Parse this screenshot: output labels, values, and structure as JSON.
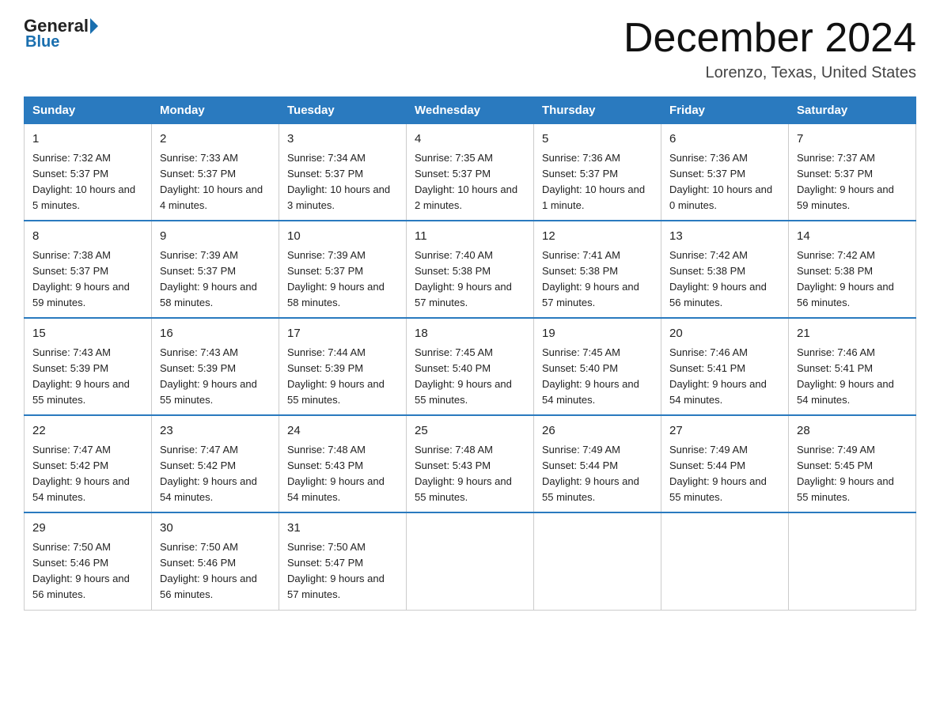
{
  "logo": {
    "general": "General",
    "blue": "Blue",
    "triangle": ""
  },
  "header": {
    "title": "December 2024",
    "subtitle": "Lorenzo, Texas, United States"
  },
  "weekdays": [
    "Sunday",
    "Monday",
    "Tuesday",
    "Wednesday",
    "Thursday",
    "Friday",
    "Saturday"
  ],
  "weeks": [
    [
      {
        "day": "1",
        "sunrise": "7:32 AM",
        "sunset": "5:37 PM",
        "daylight": "10 hours and 5 minutes."
      },
      {
        "day": "2",
        "sunrise": "7:33 AM",
        "sunset": "5:37 PM",
        "daylight": "10 hours and 4 minutes."
      },
      {
        "day": "3",
        "sunrise": "7:34 AM",
        "sunset": "5:37 PM",
        "daylight": "10 hours and 3 minutes."
      },
      {
        "day": "4",
        "sunrise": "7:35 AM",
        "sunset": "5:37 PM",
        "daylight": "10 hours and 2 minutes."
      },
      {
        "day": "5",
        "sunrise": "7:36 AM",
        "sunset": "5:37 PM",
        "daylight": "10 hours and 1 minute."
      },
      {
        "day": "6",
        "sunrise": "7:36 AM",
        "sunset": "5:37 PM",
        "daylight": "10 hours and 0 minutes."
      },
      {
        "day": "7",
        "sunrise": "7:37 AM",
        "sunset": "5:37 PM",
        "daylight": "9 hours and 59 minutes."
      }
    ],
    [
      {
        "day": "8",
        "sunrise": "7:38 AM",
        "sunset": "5:37 PM",
        "daylight": "9 hours and 59 minutes."
      },
      {
        "day": "9",
        "sunrise": "7:39 AM",
        "sunset": "5:37 PM",
        "daylight": "9 hours and 58 minutes."
      },
      {
        "day": "10",
        "sunrise": "7:39 AM",
        "sunset": "5:37 PM",
        "daylight": "9 hours and 58 minutes."
      },
      {
        "day": "11",
        "sunrise": "7:40 AM",
        "sunset": "5:38 PM",
        "daylight": "9 hours and 57 minutes."
      },
      {
        "day": "12",
        "sunrise": "7:41 AM",
        "sunset": "5:38 PM",
        "daylight": "9 hours and 57 minutes."
      },
      {
        "day": "13",
        "sunrise": "7:42 AM",
        "sunset": "5:38 PM",
        "daylight": "9 hours and 56 minutes."
      },
      {
        "day": "14",
        "sunrise": "7:42 AM",
        "sunset": "5:38 PM",
        "daylight": "9 hours and 56 minutes."
      }
    ],
    [
      {
        "day": "15",
        "sunrise": "7:43 AM",
        "sunset": "5:39 PM",
        "daylight": "9 hours and 55 minutes."
      },
      {
        "day": "16",
        "sunrise": "7:43 AM",
        "sunset": "5:39 PM",
        "daylight": "9 hours and 55 minutes."
      },
      {
        "day": "17",
        "sunrise": "7:44 AM",
        "sunset": "5:39 PM",
        "daylight": "9 hours and 55 minutes."
      },
      {
        "day": "18",
        "sunrise": "7:45 AM",
        "sunset": "5:40 PM",
        "daylight": "9 hours and 55 minutes."
      },
      {
        "day": "19",
        "sunrise": "7:45 AM",
        "sunset": "5:40 PM",
        "daylight": "9 hours and 54 minutes."
      },
      {
        "day": "20",
        "sunrise": "7:46 AM",
        "sunset": "5:41 PM",
        "daylight": "9 hours and 54 minutes."
      },
      {
        "day": "21",
        "sunrise": "7:46 AM",
        "sunset": "5:41 PM",
        "daylight": "9 hours and 54 minutes."
      }
    ],
    [
      {
        "day": "22",
        "sunrise": "7:47 AM",
        "sunset": "5:42 PM",
        "daylight": "9 hours and 54 minutes."
      },
      {
        "day": "23",
        "sunrise": "7:47 AM",
        "sunset": "5:42 PM",
        "daylight": "9 hours and 54 minutes."
      },
      {
        "day": "24",
        "sunrise": "7:48 AM",
        "sunset": "5:43 PM",
        "daylight": "9 hours and 54 minutes."
      },
      {
        "day": "25",
        "sunrise": "7:48 AM",
        "sunset": "5:43 PM",
        "daylight": "9 hours and 55 minutes."
      },
      {
        "day": "26",
        "sunrise": "7:49 AM",
        "sunset": "5:44 PM",
        "daylight": "9 hours and 55 minutes."
      },
      {
        "day": "27",
        "sunrise": "7:49 AM",
        "sunset": "5:44 PM",
        "daylight": "9 hours and 55 minutes."
      },
      {
        "day": "28",
        "sunrise": "7:49 AM",
        "sunset": "5:45 PM",
        "daylight": "9 hours and 55 minutes."
      }
    ],
    [
      {
        "day": "29",
        "sunrise": "7:50 AM",
        "sunset": "5:46 PM",
        "daylight": "9 hours and 56 minutes."
      },
      {
        "day": "30",
        "sunrise": "7:50 AM",
        "sunset": "5:46 PM",
        "daylight": "9 hours and 56 minutes."
      },
      {
        "day": "31",
        "sunrise": "7:50 AM",
        "sunset": "5:47 PM",
        "daylight": "9 hours and 57 minutes."
      },
      null,
      null,
      null,
      null
    ]
  ]
}
